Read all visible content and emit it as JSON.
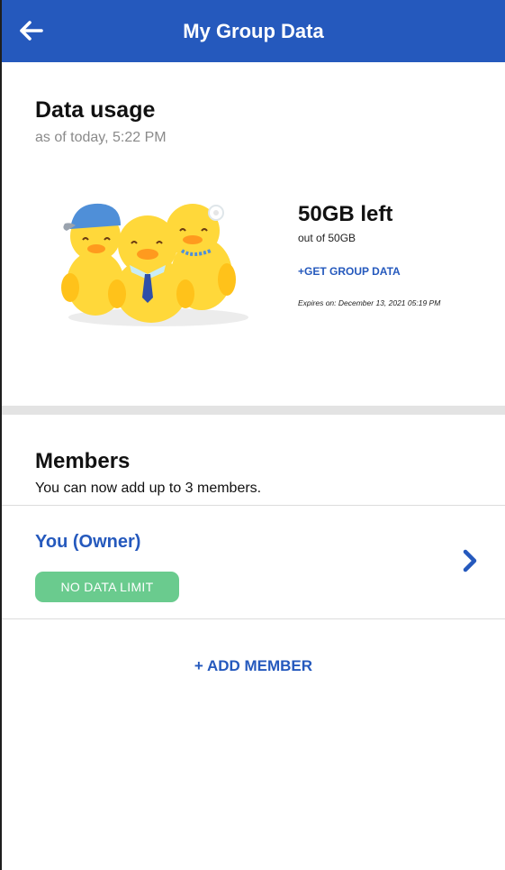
{
  "header": {
    "title": "My Group Data",
    "back_icon": "back-arrow-icon"
  },
  "usage": {
    "title": "Data usage",
    "as_of": "as of today, 5:22 PM",
    "left": "50GB left",
    "out_of": "out of 50GB",
    "get_data_label": "+GET GROUP DATA",
    "expires": "Expires on: December 13, 2021 05:19 PM",
    "remaining_fraction": 1.0
  },
  "members": {
    "title": "Members",
    "subtitle": "You can now add up to 3 members.",
    "list": [
      {
        "name": "You (Owner)",
        "badge": "NO DATA LIMIT"
      }
    ],
    "add_label": "+ ADD MEMBER"
  },
  "colors": {
    "brand": "#2559bd",
    "badge_green": "#6acb8e",
    "divider": "#e3e3e3",
    "duck_yellow": "#ffd83a"
  }
}
